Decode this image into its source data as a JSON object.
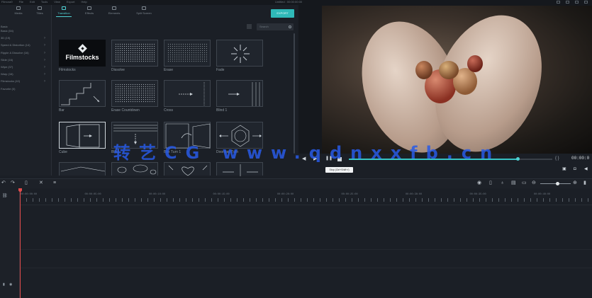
{
  "topbar": {
    "menu": [
      "Filmora9",
      "File",
      "Edit",
      "Tools",
      "View",
      "Export",
      "Help"
    ],
    "title": "Untitled : 00:00:00:00"
  },
  "tabs": [
    {
      "label": "Media",
      "icon": "media-icon"
    },
    {
      "label": "Titles",
      "icon": "titles-icon"
    },
    {
      "label": "Transition",
      "icon": "transition-icon",
      "active": true
    },
    {
      "label": "Effects",
      "icon": "effects-icon"
    },
    {
      "label": "Elements",
      "icon": "elements-icon"
    },
    {
      "label": "Split Screen",
      "icon": "split-screen-icon"
    }
  ],
  "export_label": "EXPORT",
  "search": {
    "placeholder": "Search"
  },
  "sidebar": {
    "header": "Basic",
    "items": [
      {
        "label": "Basic (54)"
      },
      {
        "label": "3D (19)",
        "has_children": true
      },
      {
        "label": "Speed & Distortion (14)",
        "has_children": true
      },
      {
        "label": "Ripple & Dissolve (16)",
        "has_children": true
      },
      {
        "label": "Slide (16)",
        "has_children": true
      },
      {
        "label": "Wipe (37)",
        "has_children": true
      },
      {
        "label": "Warp (16)",
        "has_children": true
      },
      {
        "label": "Filmstocks (10)",
        "has_children": true
      },
      {
        "label": "Favorite (0)"
      }
    ]
  },
  "transitions": [
    {
      "label": "Filmstocks",
      "kind": "filmstocks-logo"
    },
    {
      "label": "Dissolve",
      "kind": "dots"
    },
    {
      "label": "Erase",
      "kind": "dots"
    },
    {
      "label": "Fade",
      "kind": "burst"
    },
    {
      "label": "Bar",
      "kind": "steps"
    },
    {
      "label": "Erase Countdown",
      "kind": "dots"
    },
    {
      "label": "Cross",
      "kind": "arrow-right"
    },
    {
      "label": "Blind 1",
      "kind": "arrow-right"
    },
    {
      "label": "Cube",
      "kind": "cube",
      "selected": true
    },
    {
      "label": "Blind",
      "kind": "arrow-down"
    },
    {
      "label": "Box Turn 1",
      "kind": "turn"
    },
    {
      "label": "Doorway Turn",
      "kind": "doorway"
    },
    {
      "label": "",
      "kind": "lines"
    },
    {
      "label": "",
      "kind": "blobs"
    },
    {
      "label": "",
      "kind": "heart"
    },
    {
      "label": "",
      "kind": "arrows-split"
    }
  ],
  "logo_text": "Filmstocks",
  "preview": {
    "timecode": "00:00:0",
    "progress": 0.83,
    "tooltip": "Stop (Ctrl+Shift+/)",
    "brackets": "{ }"
  },
  "timeline": {
    "ruler_labels": [
      "00:00:00:00",
      "00:00:05:00",
      "00:00:10:00",
      "00:00:15:00",
      "00:00:20:00",
      "00:00:25:00",
      "00:00:30:00",
      "00:00:35:00",
      "00:00:40:00"
    ],
    "zoom_level": 0.55
  },
  "watermark": "转艺CG  www.qdnxxfb.cn",
  "colors": {
    "accent": "#2fb9b8",
    "playhead": "#e04b4b",
    "watermark": "#2c5ae6"
  }
}
